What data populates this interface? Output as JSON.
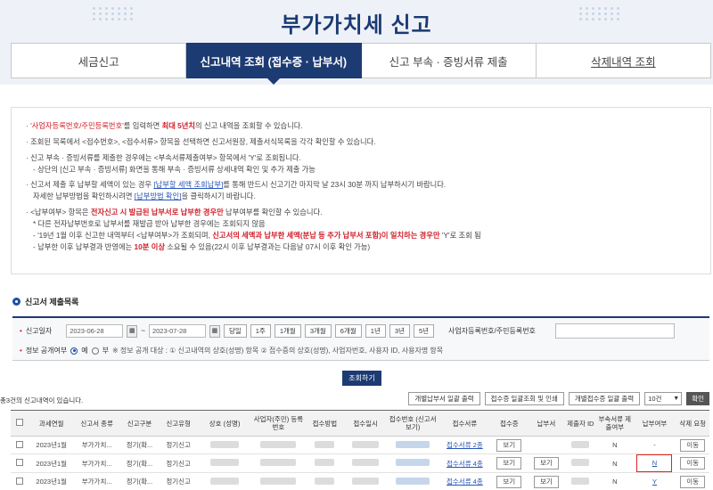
{
  "page": {
    "title": "부가가치세 신고"
  },
  "tabs": [
    {
      "label": "세금신고",
      "active": false
    },
    {
      "label": "신고내역 조회 (접수증 · 납부서)",
      "active": true
    },
    {
      "label": "신고 부속 · 증빙서류 제출",
      "active": false
    },
    {
      "label": "삭제내역 조회",
      "active": false
    }
  ],
  "info": {
    "l1a": "'사업자등록번호/주민등록번호'",
    "l1b": "를 입력하면 ",
    "l1c": "최대 5년치",
    "l1d": "의 신고 내역을 조회할 수 있습니다.",
    "l2": "조회된 목록에서 <접수번호>, <접수서류> 항목을 선택하면 신고서원장, 제출서식목록을 각각 확인할 수 있습니다.",
    "l3": "신고 부속 · 증빙서류를 제출한 경우에는 <부속서류제출여부> 항목에서 'Y'로 조회됩니다.",
    "l4": "- 상단의 [신고 부속 · 증빙서류] 화면을 통해 부속 · 증빙서류 상세내역 확인 및 추가 제출 가능",
    "l5a": "신고서 제출 후 납부할 세액이 있는 경우 ",
    "l5link": "[납부할 세액 조회납부]",
    "l5b": "를 통해 반드시 신고기간 마지막 날 23시 30분 까지 납부하시기 바랍니다.",
    "l6a": "자세한 납부방법을 확인하시려면 ",
    "l6link": "[납부방법 확인]",
    "l6b": "을 클릭하시기 바랍니다.",
    "l7a": "<납부여부> 항목은 ",
    "l7b": "전자신고 시 발급된 납부서로 납부한 경우만",
    "l7c": " 납부여부를 확인할 수 있습니다.",
    "l8": "* 다른 전자납부번호로 납부서를 재발급 받아 납부한 경우에는 조회되지 않음",
    "l9a": "- '19년 1월 이후 신고한 내역부터 <납부여부>가 조회되며, ",
    "l9b": "신고서의 세액과 납부한 세액(분납 등 추가 납부서 포함)이 일치하는 경우만",
    "l9c": " 'Y'로 조회 됨",
    "l10a": "- 납부한 이후 납부결과 반영에는 ",
    "l10b": "10분 이상",
    "l10c": " 소요될 수 있음(22시 이후 납부결과는 다음날 07시 이후 확인 가능)"
  },
  "section": {
    "title": "신고서 제출목록"
  },
  "search": {
    "date_label": "신고일자",
    "date_from": "2023-06-28",
    "date_to": "2023-07-28",
    "tilde": "~",
    "periods": [
      "당일",
      "1주",
      "1개월",
      "3개월",
      "6개월",
      "1년",
      "3년",
      "5년"
    ],
    "id_label": "사업자등록번호/주민등록번호",
    "id_placeholder": "",
    "public_label": "정보 공개여부",
    "yes_label": "예",
    "no_label": "부",
    "note": "※ 정보 공개 대상 : ① 신고내역의 상호(성명) 항목 ② 접수증의 상호(성명), 사업자번호, 사용자 ID, 사용자명 항목",
    "query_button": "조회하기"
  },
  "results": {
    "count_text": "총3건의 신고내역이 있습니다.",
    "btn_individual_pay": "개별납부서 일괄 출력",
    "btn_receipt_print": "접수증 일괄조회 및 인쇄",
    "btn_individual_receipt": "개별접수증 일괄 출력",
    "page_size": "10건",
    "confirm": "확인"
  },
  "table": {
    "headers": [
      "과세연월",
      "신고서 종류",
      "신고구분",
      "신고유형",
      "상호 (성명)",
      "사업자(주민) 등록번호",
      "접수방법",
      "접수일시",
      "접수번호 (신고서보기)",
      "접수서류",
      "접수증",
      "납부서",
      "제출자 ID",
      "부속서류 제출여부",
      "납부여부",
      "삭제 요청"
    ],
    "rows": [
      {
        "period": "2023년1월",
        "kind": "부가가치...",
        "div": "정기(확...",
        "type": "정기신고",
        "docs": "접수서류 2종",
        "receipt": "보기",
        "pay": "",
        "attach": "N",
        "paid": "-",
        "del": "이동"
      },
      {
        "period": "2023년1월",
        "kind": "부가가치...",
        "div": "정기(확...",
        "type": "정기신고",
        "docs": "접수서류 4종",
        "receipt": "보기",
        "pay": "보기",
        "attach": "N",
        "paid": "N",
        "del": "이동"
      },
      {
        "period": "2023년1월",
        "kind": "부가가치...",
        "div": "정기(확...",
        "type": "정기신고",
        "docs": "접수서류 4종",
        "receipt": "보기",
        "pay": "보기",
        "attach": "N",
        "paid": "Y",
        "del": "이동"
      }
    ]
  },
  "colors": {
    "navy": "#1d3b73",
    "red": "#d0202a",
    "link": "#2a56b8",
    "highlight": "#e3231e"
  }
}
